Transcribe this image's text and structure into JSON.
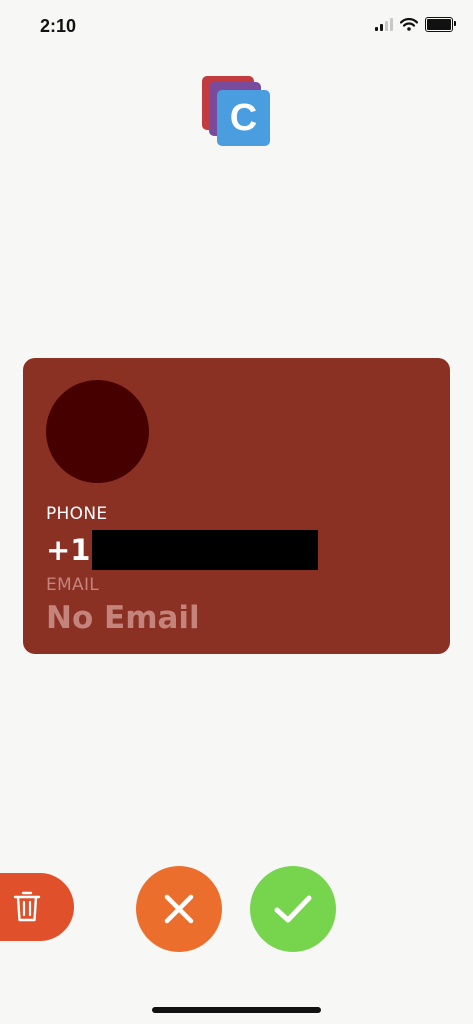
{
  "status_bar": {
    "time": "2:10",
    "battery_level": 1.0,
    "signal_bars": 2
  },
  "app": {
    "logo_letter": "C",
    "logo_colors": [
      "#c23b3e",
      "#7a4b9c",
      "#4a9ee0"
    ]
  },
  "contact_card": {
    "background_color": "#8b3124",
    "phone_label": "PHONE",
    "phone_value": "+1",
    "email_label": "EMAIL",
    "email_value": "No Email"
  },
  "actions": {
    "delete_icon": "trash-icon",
    "reject_icon": "close-icon",
    "accept_icon": "checkmark-icon",
    "delete_color": "#e0502a",
    "reject_color": "#ec6e2c",
    "accept_color": "#76d44d"
  }
}
